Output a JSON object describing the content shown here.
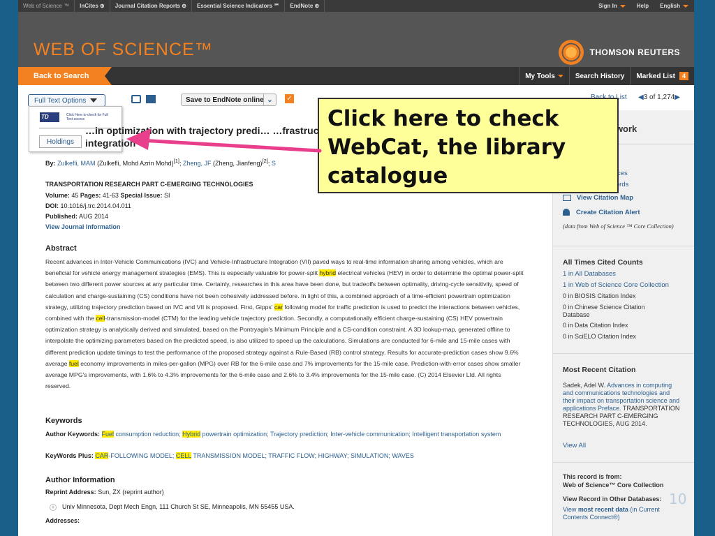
{
  "topbar": {
    "links": [
      "Web of Science ™",
      "InCites ⊕",
      "Journal Citation Reports ⊕",
      "Essential Science Indicators ℠",
      "EndNote ⊕"
    ],
    "sign_in": "Sign In",
    "help": "Help",
    "language": "English"
  },
  "brand": {
    "title": "WEB OF SCIENCE™",
    "publisher": "THOMSON REUTERS"
  },
  "nav": {
    "back": "Back to Search",
    "my_tools": "My Tools",
    "search_history": "Search History",
    "marked_list": "Marked List",
    "marked_count": "4"
  },
  "toolbar": {
    "full_text": "Full Text Options",
    "save": "Save to EndNote online",
    "back_to_list": "Back to List",
    "pager": "3 of 1,274"
  },
  "popup": {
    "logo": "TD",
    "check": "Click Here to check for Full Text access",
    "holdings": "Holdings"
  },
  "record": {
    "title": "…in optimization with trajectory predi… …frastructure integration",
    "authors_prefix": "By:",
    "author1": "Zulkefli, MAM",
    "author1_full": "(Zulkefli, Mohd Azrin Mohd)",
    "author1_sup": "[1]",
    "author2": "Zheng, JF",
    "author2_full": "(Zheng, Jianfeng)",
    "author2_sup": "[2]",
    "author3": "S",
    "journal": "TRANSPORTATION RESEARCH PART C-EMERGING TECHNOLOGIES",
    "volume_label": "Volume:",
    "volume": "45",
    "pages_label": "Pages:",
    "pages": "41-63",
    "special_label": "Special Issue:",
    "special": "SI",
    "doi_label": "DOI:",
    "doi": "10.1016/j.trc.2014.04.011",
    "published_label": "Published:",
    "published": "AUG 2014",
    "journal_info": "View Journal Information"
  },
  "abstract": {
    "heading": "Abstract",
    "p1": "Recent advances in Inter-Vehicle Communications (IVC) and Vehicle-Infrastructure Integration (VII) paved ways to real-time information sharing among vehicles, which are beneficial for vehicle energy management strategies (EMS). This is especially valuable for power-split ",
    "hl1": "hybrid",
    "p2": " electrical vehicles (HEV) in order to determine the optimal power-split between two different power sources at any particular time. Certainly, researches in this area have been done, but tradeoffs between optimality, driving-cycle sensitivity, speed of calculation and charge-sustaining (CS) conditions have not been cohesively addressed before. In light of this, a combined approach of a time-efficient powertrain optimization strategy, utilizing trajectory prediction based on IVC and VII is proposed. First, Gipps' ",
    "hl2": "car",
    "p3": " following model for traffic prediction is used to predict the interactions between vehicles, combined with the ",
    "hl3": "cell",
    "p4": "-transmission-model (CTM) for the leading vehicle trajectory prediction. Secondly, a computationally efficient charge-sustaining (CS) HEV powertrain optimization strategy is analytically derived and simulated, based on the Pontryagin's Minimum Principle and a CS-condition constraint. A 3D lookup-map, generated offline to interpolate the optimizing parameters based on the predicted speed, is also utilized to speed up the calculations. Simulations are conducted for 6-mile and 15-mile cases with different prediction update timings to test the performance of the proposed strategy against a Rule-Based (RB) control strategy. Results for accurate-prediction cases show 9.6% average ",
    "hl4": "fuel",
    "p5": " economy improvements in miles-per-gallon (MPG) over RB for the 6-mile case and 7% improvements for the 15-mile case. Prediction-with-error cases show smaller average MPG's improvements, with 1.6% to 4.3% improvements for the 6-mile case and 2.6% to 3.4% improvements for the 15-mile case. (C) 2014 Elsevier Ltd. All rights reserved."
  },
  "keywords": {
    "heading": "Keywords",
    "author_label": "Author Keywords:",
    "a_hl1": "Fuel",
    "a1": " consumption reduction; ",
    "a_hl2": "Hybrid",
    "a2": " powertrain optimization; Trajectory prediction; Inter-vehicle communication; Intelligent transportation system",
    "plus_label": "KeyWords Plus:",
    "p_hl1": "CAR",
    "p1": "-FOLLOWING MODEL; ",
    "p_hl2": "CELL",
    "p2": " TRANSMISSION MODEL; TRAFFIC FLOW; HIGHWAY; SIMULATION; WAVES"
  },
  "author_info": {
    "heading": "Author Information",
    "reprint_label": "Reprint Address:",
    "reprint": "Sun, ZX (reprint author)",
    "address1": "Univ Minnesota, Dept Mech Engn, 111 Church St SE, Minneapolis, MN 55455 USA.",
    "addresses": "Addresses:"
  },
  "sidebar": {
    "title": "Network",
    "cited_suffix": "d",
    "refs_suffix": "erences",
    "records_suffix": "Records",
    "citation_map": "View Citation Map",
    "citation_alert": "Create Citation Alert",
    "data_from": "(data from Web of Science ™ Core Collection)",
    "counts_heading": "All Times Cited Counts",
    "c1": "1 in All Databases",
    "c2": "1 in Web of Science Core Collection",
    "c3": "0 in BIOSIS Citation Index",
    "c4": "0 in Chinese Science Citation Database",
    "c5": "0 in Data Citation Index",
    "c6": "0 in SciELO Citation Index",
    "recent_heading": "Most Recent Citation",
    "recent_author": "Sadek, Adel W.",
    "recent_title": "Advances in computing and communications technologies and their impact on transportation science and applications Preface.",
    "recent_journal": "TRANSPORTATION RESEARCH PART C-EMERGING TECHNOLOGIES, AUG 2014.",
    "view_all": "View All",
    "record_from": "This record is from:",
    "record_db": "Web of Science™ Core Collection",
    "other_db": "View Record in Other Databases:",
    "view_most": "View",
    "most_recent": "most recent data",
    "in_current": "(in Current Contents Connect®)"
  },
  "callout": {
    "text": "Click here to check WebCat, the library catalogue"
  },
  "slide_number": "10",
  "colors": {
    "accent": "#f48120",
    "link": "#2c5f8f",
    "highlight": "#ffea00",
    "arrow": "#e83e8c",
    "callout_bg": "#ffff99"
  }
}
